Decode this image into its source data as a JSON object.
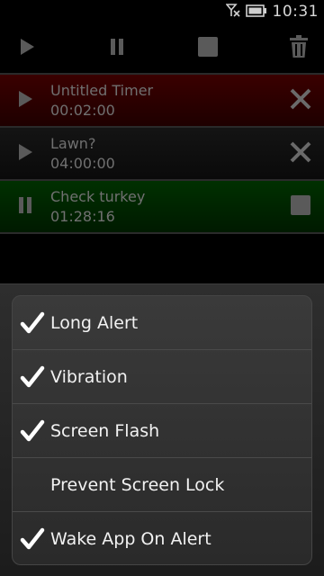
{
  "status": {
    "time": "10:31",
    "icons": [
      "no-signal-icon",
      "battery-icon"
    ]
  },
  "toolbar": {
    "icons": [
      "play-all-icon",
      "pause-all-icon",
      "stop-all-icon",
      "delete-icon"
    ]
  },
  "timers": [
    {
      "name": "Untitled Timer",
      "time": "00:02:00",
      "state": "stopped",
      "color": "#3a0000",
      "left_icon": "play-icon",
      "right_icon": "close-icon"
    },
    {
      "name": "Lawn?",
      "time": "04:00:00",
      "state": "stopped",
      "color": "#141414",
      "left_icon": "play-icon",
      "right_icon": "close-icon"
    },
    {
      "name": "Check turkey",
      "time": "01:28:16",
      "state": "running",
      "color": "#003000",
      "left_icon": "pause-icon",
      "right_icon": "stop-icon"
    }
  ],
  "menu": {
    "items": [
      {
        "label": "Long Alert",
        "checked": true
      },
      {
        "label": "Vibration",
        "checked": true
      },
      {
        "label": "Screen Flash",
        "checked": true
      },
      {
        "label": "Prevent Screen Lock",
        "checked": false
      },
      {
        "label": "Wake App On Alert",
        "checked": true
      }
    ]
  }
}
